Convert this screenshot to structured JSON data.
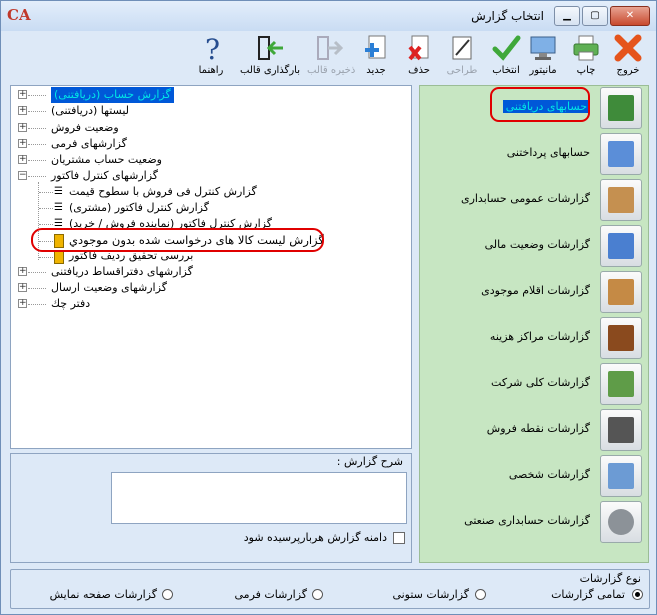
{
  "window": {
    "title": "انتخاب گزارش",
    "logo": "CA",
    "icons": {
      "close": "close-icon",
      "maximize": "maximize-icon",
      "minimize": "minimize-icon"
    }
  },
  "toolbar": {
    "exit": "خروج",
    "print": "چاپ",
    "monitor": "مانیتور",
    "select": "انتخاب",
    "design": "طراحی",
    "delete": "حذف",
    "new": "جدید",
    "save_template": "ذخیره قالب",
    "load_template": "بارگذاری قالب",
    "help": "راهنما"
  },
  "tree": {
    "items": [
      {
        "label": "گزارش حساب (دریافتنی)",
        "selected": true
      },
      {
        "label": "لیستها (دریافتنی)"
      },
      {
        "label": "وضعیت فروش"
      },
      {
        "label": "گزارشهای فرمی"
      },
      {
        "label": "وضعیت حساب مشتریان"
      },
      {
        "label": "گزارشهای کنترل فاکتور"
      },
      {
        "label": "گزارش کنترل فی فروش با سطوح قیمت"
      },
      {
        "label": "گزارش کنترل فاکتور (مشتری)"
      },
      {
        "label": "گزارش کنترل فاکتور (نماینده فروش / خرید)"
      },
      {
        "label": "گزارش لیست کالا های درخواست شده بدون موجودي"
      },
      {
        "label": "بررسی تحقیق ردیف فاکتور"
      },
      {
        "label": "گزارشهای دفتراقساط دریافتنی"
      },
      {
        "label": "گزارشهای وضعیت ارسال"
      },
      {
        "label": "دفتر چك"
      }
    ]
  },
  "description": {
    "legend": "شرح گزارش :",
    "text": "",
    "domain_label": "دامنه گزارش هربارپرسیده شود",
    "domain_checked": false
  },
  "side": {
    "items": [
      {
        "label": "حسابهای دریافتنی",
        "highlight": true,
        "icon": "cash-icon",
        "color": "#3f8b3a"
      },
      {
        "label": "حسابهای پرداختنی",
        "icon": "card-icon",
        "color": "#5b8ed8"
      },
      {
        "label": "گزارشات عمومی حسابداری",
        "icon": "clipboard-icon",
        "color": "#c59050"
      },
      {
        "label": "گزارشات وضعیت مالی",
        "icon": "chart-icon",
        "color": "#4a7fd0"
      },
      {
        "label": "گزارشات اقلام موجودی",
        "icon": "boxes-icon",
        "color": "#c58a45"
      },
      {
        "label": "گزارشات مراکز هزینه",
        "icon": "wallet-icon",
        "color": "#8a4a1e"
      },
      {
        "label": "گزارشات کلی شرکت",
        "icon": "money-icon",
        "color": "#5f9c48"
      },
      {
        "label": "گزارشات نقطه فروش",
        "icon": "register-icon",
        "color": "#555555"
      },
      {
        "label": "گزارشات شخصی",
        "icon": "document-icon",
        "color": "#6c9bd4"
      },
      {
        "label": "گزارشات حسابداری صنعتی",
        "icon": "gear-icon",
        "color": "#8c9298"
      }
    ]
  },
  "types": {
    "legend": "نوع گزارشات",
    "options": [
      {
        "label": "تمامی گزارشات",
        "checked": true
      },
      {
        "label": "گزارشات ستونی",
        "checked": false
      },
      {
        "label": "گزارشات فرمی",
        "checked": false
      },
      {
        "label": "گزارشات صفحه نمایش",
        "checked": false
      }
    ]
  },
  "colors": {
    "highlight_text": "#00e6e6",
    "highlight_bg": "#0058d8",
    "annotation": "#e00000"
  }
}
